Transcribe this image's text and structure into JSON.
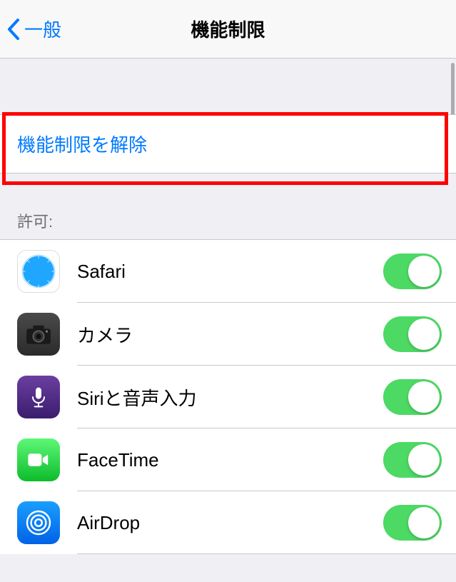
{
  "navbar": {
    "back_label": "一般",
    "title": "機能制限"
  },
  "action": {
    "disable_restrictions": "機能制限を解除"
  },
  "section": {
    "allow_header": "許可:"
  },
  "apps": [
    {
      "name": "Safari",
      "icon": "safari",
      "enabled": true
    },
    {
      "name": "カメラ",
      "icon": "camera",
      "enabled": true
    },
    {
      "name": "Siriと音声入力",
      "icon": "siri",
      "enabled": true
    },
    {
      "name": "FaceTime",
      "icon": "facetime",
      "enabled": true
    },
    {
      "name": "AirDrop",
      "icon": "airdrop",
      "enabled": true
    }
  ],
  "colors": {
    "accent": "#007aff",
    "toggle_on": "#4cd964",
    "highlight": "#ff0000"
  }
}
